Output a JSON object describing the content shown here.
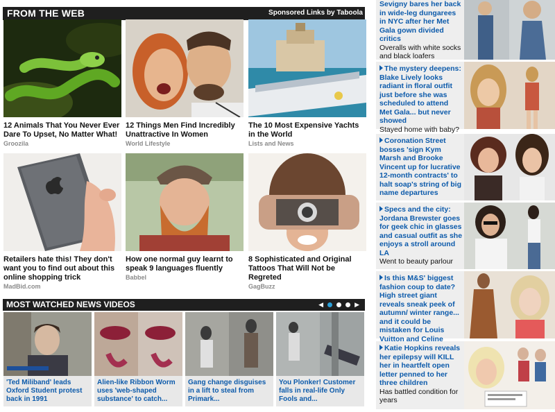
{
  "web": {
    "title": "FROM THE WEB",
    "sponsor": "Sponsored Links by Taboola",
    "tiles": [
      {
        "caption": "12 Animals That You Never Ever Dare To Upset, No Matter What!",
        "source": "Groozila",
        "image": "green-snake-photo"
      },
      {
        "caption": "12 Things Men Find Incredibly Unattractive In Women",
        "source": "World Lifestyle",
        "image": "couple-shouting-photo"
      },
      {
        "caption": "The 10 Most Expensive Yachts in the World",
        "source": "Lists and News",
        "image": "luxury-yacht-photo"
      },
      {
        "caption": "Retailers hate this! They don't want you to find out about this online shopping trick",
        "source": "MadBid.com",
        "image": "hand-holding-iphone-photo"
      },
      {
        "caption": "How one normal guy learnt to speak 9 languages fluently",
        "source": "Babbel",
        "image": "bearded-man-cap-photo"
      },
      {
        "caption": "8 Sophisticated and Original Tattoos That Will Not be Regreted",
        "source": "GagBuzz",
        "image": "camera-tattoo-arm-photo"
      }
    ]
  },
  "videos": {
    "title": "MOST WATCHED NEWS VIDEOS",
    "prev_icon": "triangle-left-icon",
    "next_icon": "triangle-right-icon",
    "active_page": 1,
    "page_count": 3,
    "items": [
      {
        "caption": "'Ted Miliband' leads Oxford Student protest back in 1991",
        "image": "student-protest-video"
      },
      {
        "caption": "Alien-like Ribbon Worm uses 'web-shaped substance' to catch...",
        "image": "ribbon-worm-video"
      },
      {
        "caption": "Gang change disguises in a lift to steal from Primark...",
        "image": "lift-cctv-video"
      },
      {
        "caption": "You Plonker! Customer falls in real-life Only Fools and...",
        "image": "shop-fall-cctv-video"
      }
    ]
  },
  "side": {
    "items": [
      {
        "headline": "Sevigny bares her back in wide-leg dungarees in NYC after her Met Gala gown divided critics",
        "sub": "Overalls with white socks and black loafers",
        "image": "celebrity-dungarees-photo",
        "arrow": false
      },
      {
        "headline": "The mystery deepens: Blake Lively looks radiant in floral outfit just before she was scheduled to attend Met Gala... but never showed",
        "sub": "Stayed home with baby?",
        "image": "blake-lively-photo",
        "arrow": true
      },
      {
        "headline": "Coronation Street bosses 'sign Kym Marsh and Brooke Vincent up for lucrative 12-month contracts' to halt soap's string of big name departures",
        "sub": "",
        "image": "coronation-street-stars-photo",
        "arrow": true
      },
      {
        "headline": "Specs and the city: Jordana Brewster goes for geek chic in glasses and casual outfit as she enjoys a stroll around LA",
        "sub": "Went to beauty parlour",
        "image": "jordana-brewster-photo",
        "arrow": true
      },
      {
        "headline": "Is this M&S' biggest fashion coup to date? High street giant reveals sneak peek of autumn/ winter range... and it could be mistaken for Louis Vuitton and Celine",
        "sub": "",
        "image": "ms-fashion-photo",
        "arrow": true
      },
      {
        "headline": "Katie Hopkins reveals her epilepsy will KILL her in heartfelt open letter penned to her three children",
        "sub": "Has battled condition for years",
        "image": "katie-hopkins-photo",
        "arrow": true
      }
    ]
  }
}
